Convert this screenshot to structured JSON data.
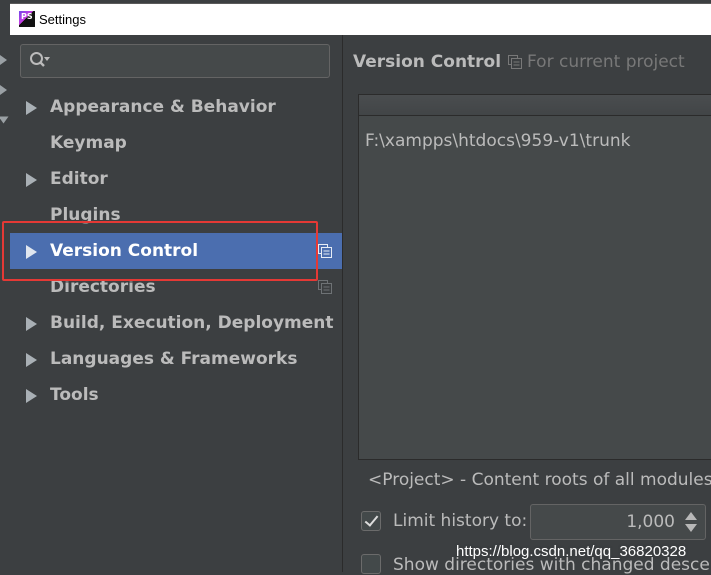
{
  "window": {
    "title": "Settings",
    "app_icon_text": "PS"
  },
  "search": {
    "icon": "search-icon",
    "value": ""
  },
  "sidebar": {
    "items": [
      {
        "label": "Appearance & Behavior",
        "expandable": true,
        "selected": false
      },
      {
        "label": "Keymap",
        "expandable": false,
        "selected": false
      },
      {
        "label": "Editor",
        "expandable": true,
        "selected": false
      },
      {
        "label": "Plugins",
        "expandable": false,
        "selected": false
      },
      {
        "label": "Version Control",
        "expandable": true,
        "selected": true,
        "project_icon": true
      },
      {
        "label": "Directories",
        "expandable": false,
        "selected": false,
        "project_icon": true
      },
      {
        "label": "Build, Execution, Deployment",
        "expandable": true,
        "selected": false
      },
      {
        "label": "Languages & Frameworks",
        "expandable": true,
        "selected": false
      },
      {
        "label": "Tools",
        "expandable": true,
        "selected": false
      }
    ]
  },
  "content": {
    "title": "Version Control",
    "scope_note": "For current project",
    "mappings": [
      "F:\\xampps\\htdocs\\959-v1\\trunk"
    ],
    "project_note": "<Project> - Content roots of all modules, a",
    "limit_history": {
      "label": "Limit history to:",
      "checked": true,
      "value": "1,000"
    },
    "show_directories": {
      "label": "Show directories with changed descend",
      "checked": false
    }
  },
  "watermark": "https://blog.csdn.net/qq_36820328",
  "colors": {
    "background": "#3c3f41",
    "selection": "#4b6eaf",
    "highlight_box": "#e53935",
    "text": "#bbbbbb"
  }
}
